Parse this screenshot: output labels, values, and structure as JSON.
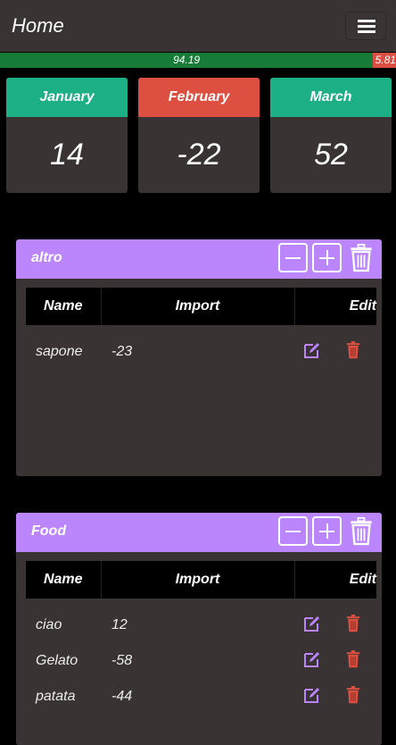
{
  "header": {
    "title": "Home",
    "menu_icon": "hamburger-icon"
  },
  "progress": {
    "positive_label": "94.19",
    "negative_label": "5.81",
    "positive_percent": 94.19,
    "positive_color": "#177c38",
    "negative_color": "#db4e42"
  },
  "months": [
    {
      "name": "January",
      "value": "14",
      "color": "#1daf86"
    },
    {
      "name": "February",
      "value": "-22",
      "color": "#dc4f41"
    },
    {
      "name": "March",
      "value": "52",
      "color": "#1daf86"
    }
  ],
  "table_headers": {
    "name": "Name",
    "import": "Import",
    "edit": "Edit"
  },
  "categories": [
    {
      "title": "altro",
      "items": [
        {
          "name": "sapone",
          "import": "-23"
        }
      ]
    },
    {
      "title": "Food",
      "items": [
        {
          "name": "ciao",
          "import": "12"
        },
        {
          "name": "Gelato",
          "import": "-58"
        },
        {
          "name": "patata",
          "import": "-44"
        }
      ]
    }
  ]
}
